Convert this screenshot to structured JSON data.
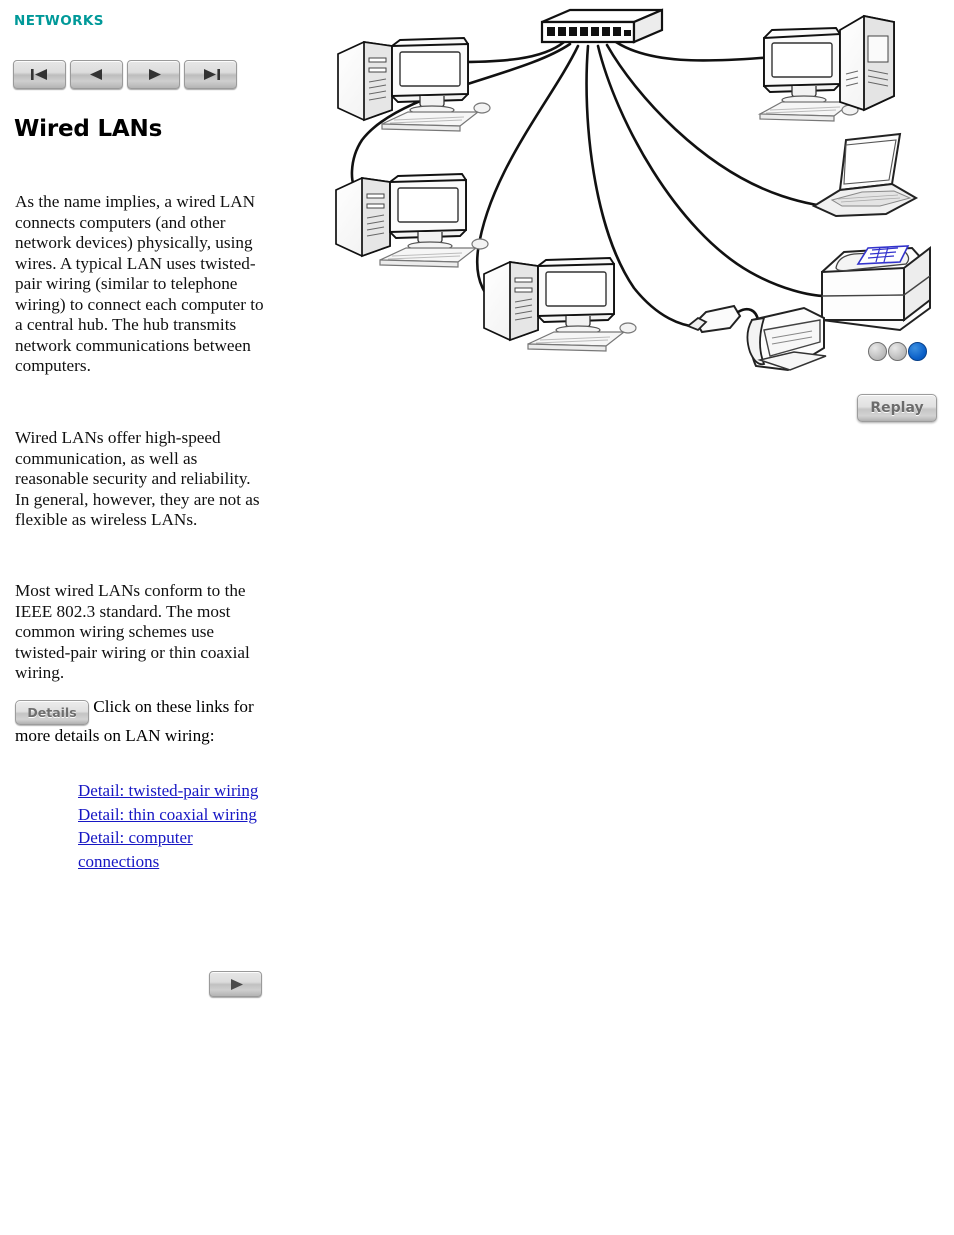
{
  "section_label": "NETWORKS",
  "page_title": "Wired LANs",
  "nav": {
    "first_label": "first-page",
    "prev_label": "previous-page",
    "next_label": "next-page",
    "last_label": "last-page"
  },
  "paragraphs": {
    "p1": "As the name implies, a wired LAN connects computers (and other network devices) physically, using wires. A typical LAN uses twisted-pair wiring (similar to telephone wiring) to connect each computer to a central hub. The hub transmits network communications between computers.",
    "p2": "Wired LANs offer high-speed communication, as well as reasonable security and reliability. In general, however, they are not as flexible as wireless LANs.",
    "p3": "Most wired LANs conform to the IEEE 802.3 standard. The most common wiring schemes use twisted-pair wiring or thin coaxial wiring."
  },
  "details": {
    "button_label": "Details",
    "intro_text": " Click on these links for more details on LAN wiring:"
  },
  "links": [
    {
      "label": "Detail: twisted-pair wiring"
    },
    {
      "label": "Detail: thin coaxial wiring"
    },
    {
      "label": "Detail: computer connections"
    }
  ],
  "bottom_play": {
    "label": "play-animation"
  },
  "diagram": {
    "caption": "",
    "hub": {
      "name": "network-hub",
      "ports": 8
    },
    "devices": [
      {
        "name": "desktop-computer-top-left"
      },
      {
        "name": "desktop-computer-top-right"
      },
      {
        "name": "desktop-computer-middle-left"
      },
      {
        "name": "desktop-computer-bottom-center"
      },
      {
        "name": "laptop-computer-right"
      },
      {
        "name": "laser-printer-right"
      },
      {
        "name": "inkjet-printer-bottom-right"
      },
      {
        "name": "print-server-adapter"
      }
    ]
  },
  "step_indicator": {
    "total": 3,
    "current": 3,
    "inactive_color": "#b9b9b9",
    "active_color": "#0a5fc8"
  },
  "replay": {
    "label": "Replay"
  },
  "colors": {
    "section_label": "#009999",
    "link": "#1717c4",
    "text": "#111111",
    "page_background": "#ffffff",
    "document_accent": "#3333cc"
  }
}
